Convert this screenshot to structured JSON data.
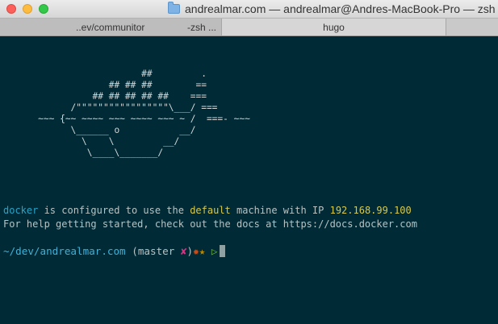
{
  "window": {
    "title": "andrealmar.com — andrealmar@Andres-MacBook-Pro — zsh --l"
  },
  "tabs": [
    {
      "label": "..ev/communitor",
      "sub_label": "-zsh ..."
    },
    {
      "label": "hugo"
    }
  ],
  "terminal": {
    "ascii_art": "                          ##         .\n                    ## ## ##        ==\n                 ## ## ## ## ##    ===\n             /\"\"\"\"\"\"\"\"\"\"\"\"\"\"\"\"\"\\___/ ===\n       ~~~ {~~ ~~~~ ~~~ ~~~~ ~~~ ~ /  ===- ~~~\n             \\______ o           __/\n               \\    \\         __/\n                \\____\\_______/",
    "line1": {
      "docker": "docker",
      "text_a": " is configured to use the ",
      "default": "default",
      "text_b": " machine with IP ",
      "ip": "192.168.99.100"
    },
    "line2": "For help getting started, check out the docs at https://docs.docker.com",
    "prompt": {
      "path": "~/dev/andrealmar.com",
      "branch_open": " (master ",
      "dirty": "✘",
      "branch_close": ")",
      "dot": "✹",
      "star": "★",
      "arrow": " ▷"
    }
  },
  "colors": {
    "background": "#002b36",
    "cyan": "#29a3c7",
    "yellow": "#d8c84a",
    "magenta": "#d33682"
  }
}
